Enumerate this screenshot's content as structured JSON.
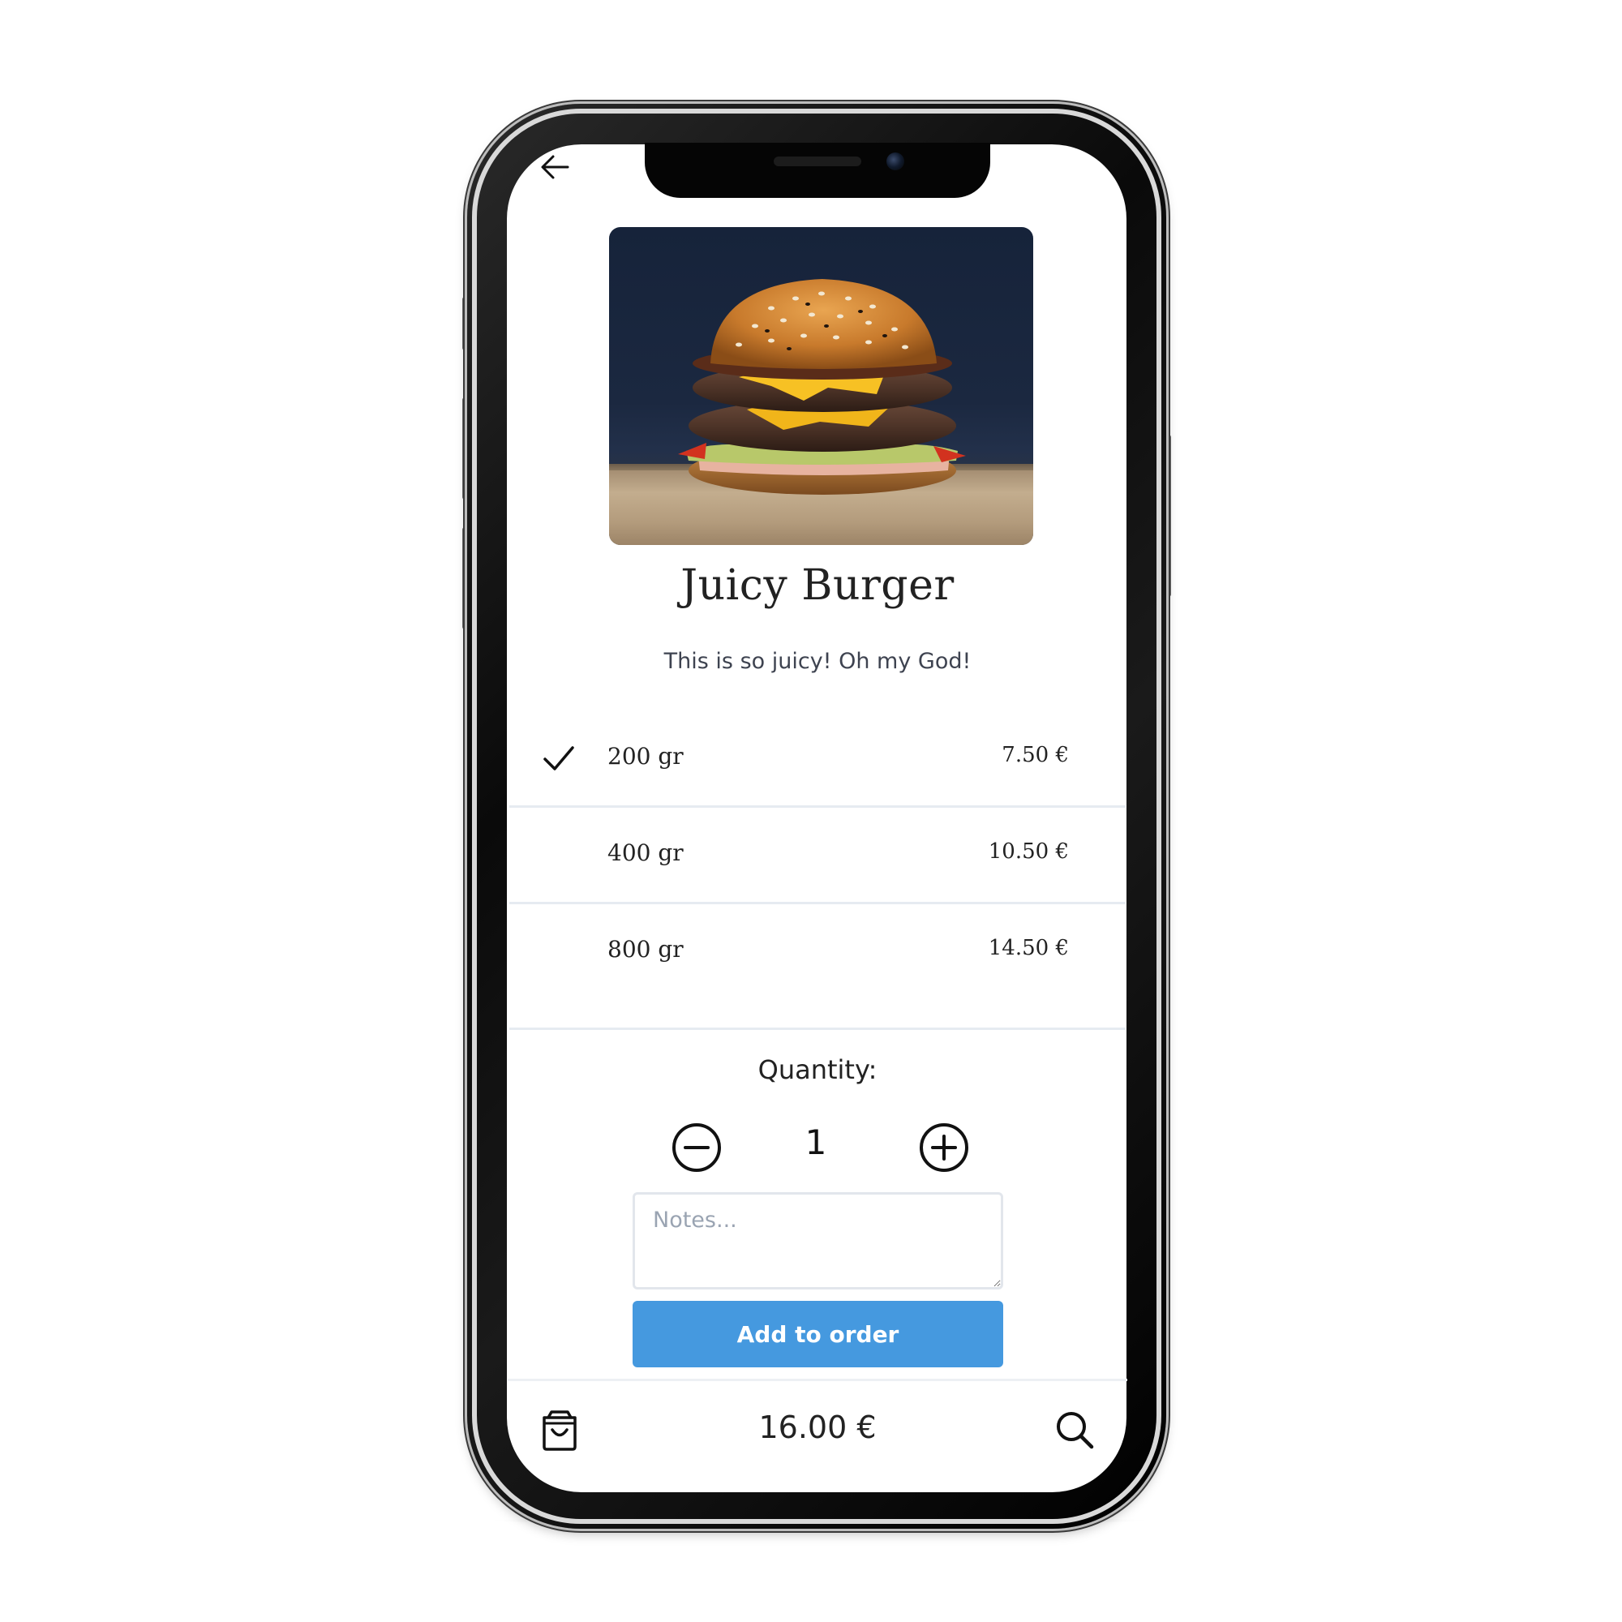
{
  "product": {
    "name": "Juicy Burger",
    "description": "This is so juicy! Oh my God!",
    "image_alt": "burger-photo"
  },
  "options": [
    {
      "size": "200 gr",
      "price": "7.50 €",
      "selected": true
    },
    {
      "size": "400 gr",
      "price": "10.50 €",
      "selected": false
    },
    {
      "size": "800 gr",
      "price": "14.50 €",
      "selected": false
    }
  ],
  "quantity": {
    "label": "Quantity:",
    "value": "1"
  },
  "notes": {
    "placeholder": "Notes...",
    "value": ""
  },
  "actions": {
    "add_to_order": "Add to order"
  },
  "footer": {
    "total": "16.00 €",
    "left_icon": "shopping-bag-icon",
    "right_icon": "search-icon"
  },
  "colors": {
    "primary_button": "#4599df",
    "divider": "#e6ebf1",
    "text": "#222222",
    "placeholder": "#9aa4b2"
  }
}
